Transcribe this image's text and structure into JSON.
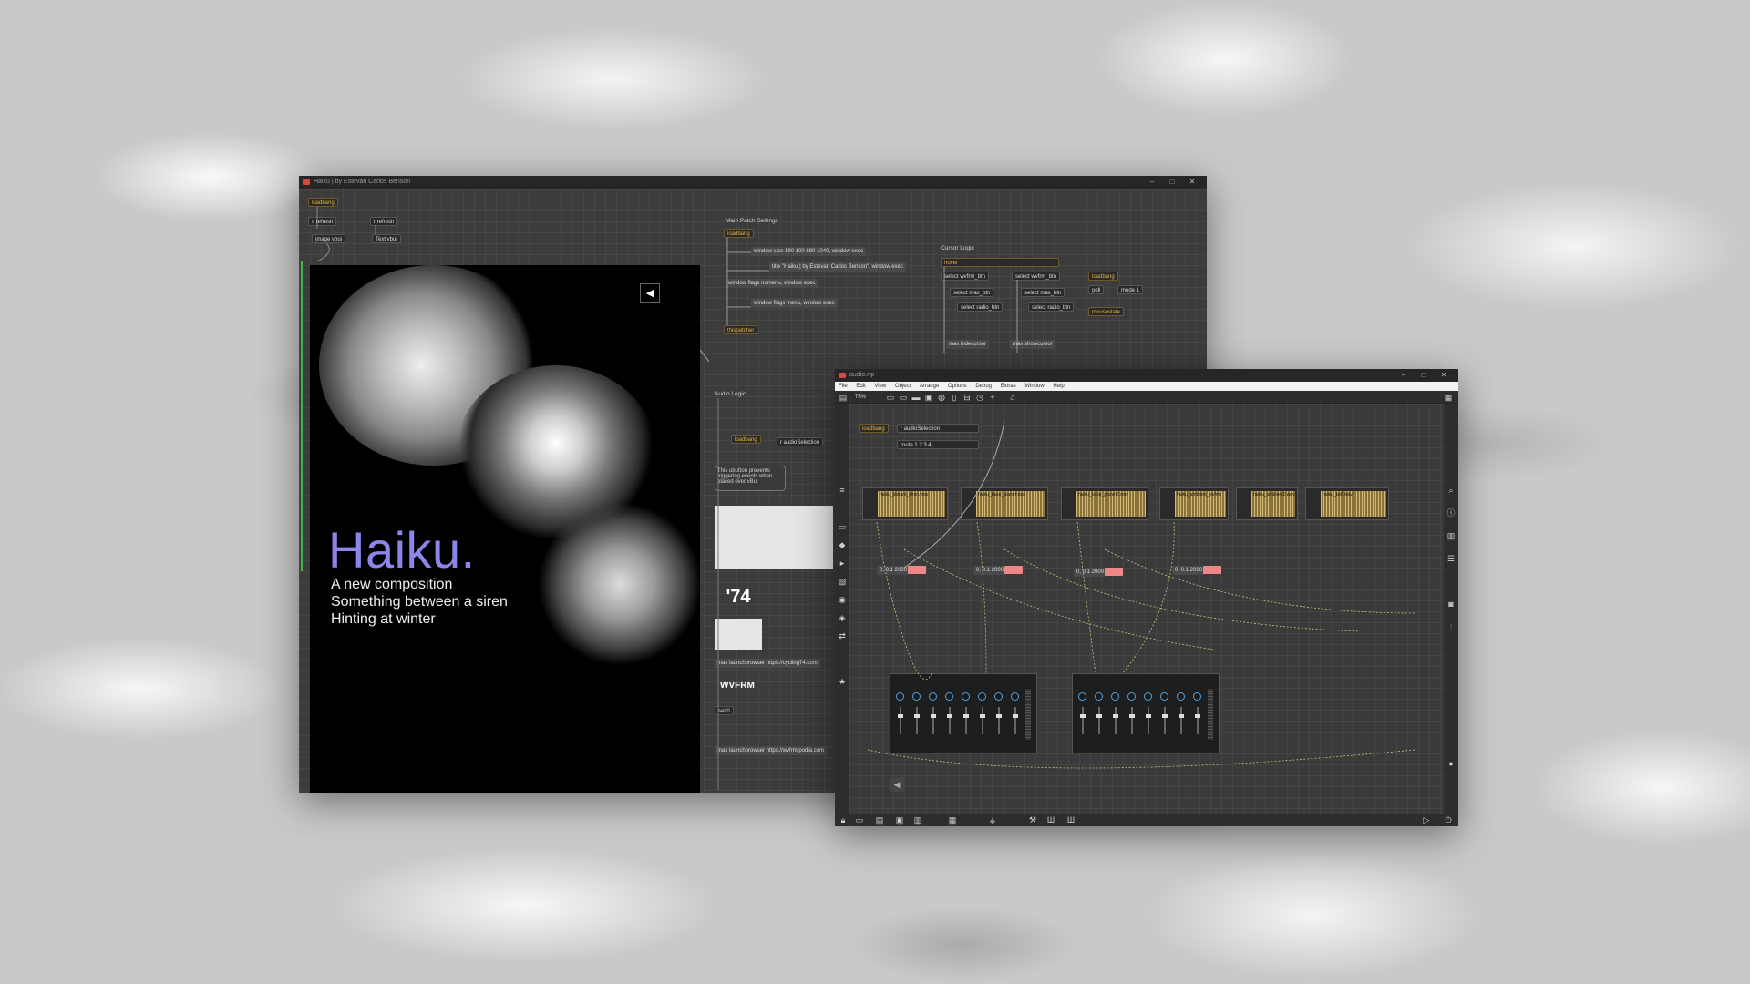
{
  "main_window": {
    "title": "Haiku | by Estevan Carlos Benson",
    "objects": {
      "loadbang": "loadbang",
      "refresh_btn": "s refresh",
      "refresh_recv": "r refresh",
      "image_vbui": "image vbui",
      "text_vbui": "Text vbui",
      "main_patch_settings": "Main Patch Settings",
      "loadbang2": "loadbang",
      "window_size": "window size 190 100 880 1040, window exec",
      "title_msg": "title \"Haiku | by Estevan Carlos Benson\", window exec",
      "window_flags_nomenu": "window flags nomenu, window exec",
      "window_flags_menu": "window flags menu, window exec",
      "thispatcher": "thispatcher",
      "cursor_logic": "Cursor Logic",
      "hover": "hover",
      "select_wvfrm_btn": "select wvfrm_btn",
      "select_max_btn": "select max_btn",
      "select_radio_btn": "select radio_btn",
      "max_hidecursor": "max hidecursor",
      "max_showcursor": "max showcursor",
      "loadbang3": "loadbang",
      "poll": "poll",
      "mode1": "mode 1",
      "mousestate": "mousestate",
      "audio_logic": "Audio Logic",
      "loadbang4": "loadbang",
      "r_audioSelection": "r audioSelection",
      "ubutton_comment": "This ubutton prevents triggering events when placed over vBui",
      "launch_cycling": "max launchbrowser https://cycling74.com",
      "wvfrm_label": "WVFRM",
      "sel0": "sel 0",
      "launch_wvfrm": "max launchbrowser https://wvfrm.podia.com"
    },
    "haiku": {
      "title": "Haiku.",
      "line1": "A new composition",
      "line2": "Something between a siren",
      "line3": "Hinting at winter"
    }
  },
  "audio_window": {
    "title": "audio.rtp",
    "menu": [
      "File",
      "Edit",
      "View",
      "Object",
      "Arrange",
      "Options",
      "Debug",
      "Extras",
      "Window",
      "Help"
    ],
    "zoom": "75%",
    "tracks": [
      "haiku_distant_siren.wav",
      "haiku_base_pianet.wav",
      "haiku_base_pianet2.wav",
      "haiku_ambient_wvfrm",
      "haiku_ambient2.wav",
      "haiku_bell.wav"
    ],
    "line_values": [
      "0, 0.1 2000",
      "0, 0.1 2000",
      "0, 0.1 2000",
      "0, 0.1 2000"
    ],
    "loadbang": "loadbang",
    "r_audioSelection": "r audioSelection",
    "route": "route 1 2 3 4"
  }
}
